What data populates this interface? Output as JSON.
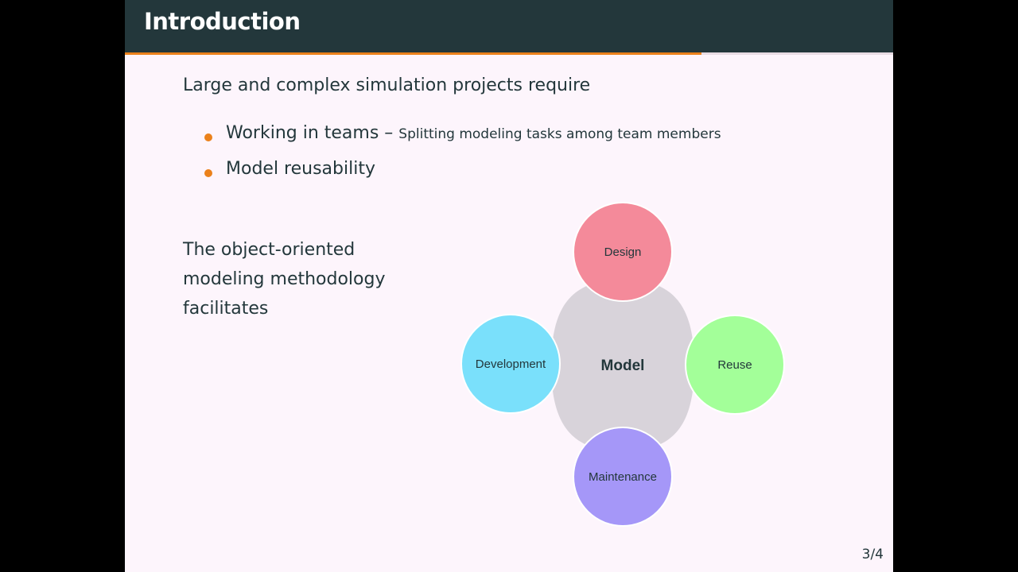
{
  "slide": {
    "title": "Introduction",
    "progress": 0.75,
    "intro": "Large and complex simulation projects require",
    "bullets": [
      {
        "main": "Working in teams – ",
        "sub": "Splitting modeling tasks among team members"
      },
      {
        "main": "Model reusability",
        "sub": ""
      }
    ],
    "methodology": "The object-oriented modeling methodology facilitates",
    "page_number": "3/4"
  },
  "diagram": {
    "center": {
      "label": "Model",
      "color": "#d8d3da"
    },
    "nodes": [
      {
        "label": "Design",
        "color": "#f48a9a"
      },
      {
        "label": "Reuse",
        "color": "#a3ff99"
      },
      {
        "label": "Maintenance",
        "color": "#a597f8"
      },
      {
        "label": "Development",
        "color": "#7ae0fb"
      }
    ]
  },
  "colors": {
    "title_bar": "#23373b",
    "accent": "#eb811b",
    "slide_bg": "#fdf5fc"
  }
}
